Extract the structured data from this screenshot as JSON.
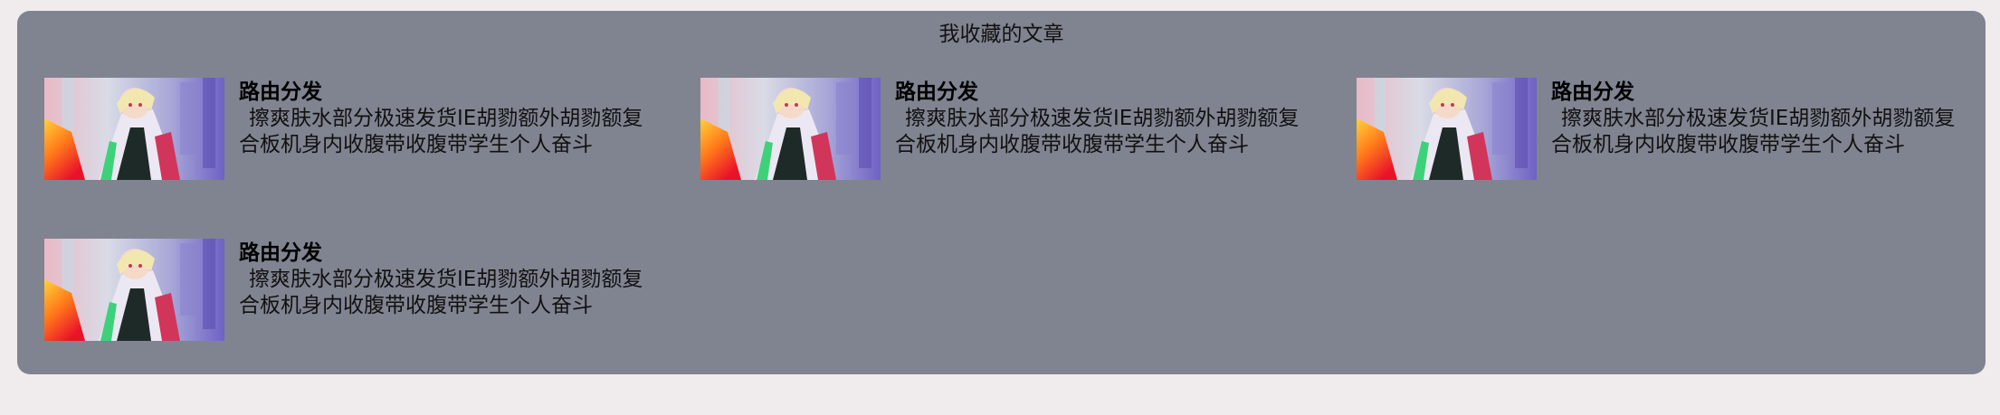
{
  "panel": {
    "title": "我收藏的文章"
  },
  "colors": {
    "page_bg": "#f0eced",
    "panel_bg": "#808491"
  },
  "articles": [
    {
      "title": "路由分发",
      "description": "擦爽肤水部分极速发货IE胡勠额外胡勠额复合板机身内收腹带收腹带学生个人奋斗",
      "thumbnail": "anime-girl-artwork"
    },
    {
      "title": "路由分发",
      "description": "擦爽肤水部分极速发货IE胡勠额外胡勠额复合板机身内收腹带收腹带学生个人奋斗",
      "thumbnail": "anime-girl-artwork"
    },
    {
      "title": "路由分发",
      "description": "擦爽肤水部分极速发货IE胡勠额外胡勠额复合板机身内收腹带收腹带学生个人奋斗",
      "thumbnail": "anime-girl-artwork"
    },
    {
      "title": "路由分发",
      "description": "擦爽肤水部分极速发货IE胡勠额外胡勠额复合板机身内收腹带收腹带学生个人奋斗",
      "thumbnail": "anime-girl-artwork"
    }
  ]
}
